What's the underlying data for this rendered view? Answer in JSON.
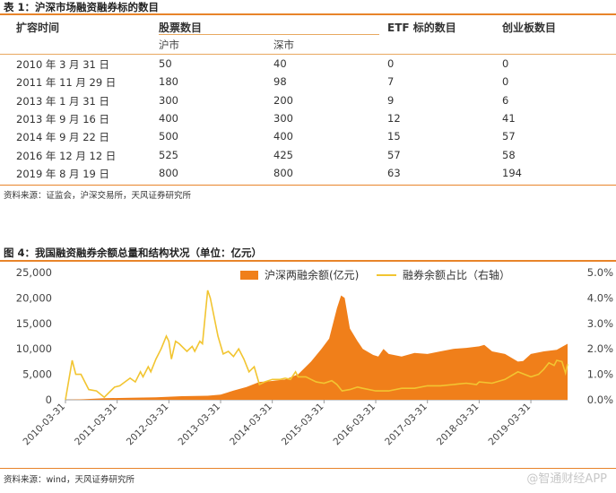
{
  "table": {
    "title": "表 1：沪深市场融资融券标的数目",
    "headers": {
      "date": "扩容时间",
      "stocks": "股票数目",
      "sh": "沪市",
      "sz": "深市",
      "etf": "ETF 标的数目",
      "gem": "创业板数目"
    },
    "rows": [
      {
        "date": "2010 年 3 月 31 日",
        "sh": "50",
        "sz": "40",
        "etf": "0",
        "gem": "0"
      },
      {
        "date": "2011 年 11 月 29 日",
        "sh": "180",
        "sz": "98",
        "etf": "7",
        "gem": "0"
      },
      {
        "date": "2013 年 1 月 31 日",
        "sh": "300",
        "sz": "200",
        "etf": "9",
        "gem": "6"
      },
      {
        "date": "2013 年 9 月 16 日",
        "sh": "400",
        "sz": "300",
        "etf": "12",
        "gem": "41"
      },
      {
        "date": "2014 年 9 月 22 日",
        "sh": "500",
        "sz": "400",
        "etf": "15",
        "gem": "57"
      },
      {
        "date": "2016 年 12 月 12 日",
        "sh": "525",
        "sz": "425",
        "etf": "57",
        "gem": "58"
      },
      {
        "date": "2019 年 8 月 19 日",
        "sh": "800",
        "sz": "800",
        "etf": "63",
        "gem": "194"
      }
    ],
    "source": "资料来源：证监会，沪深交易所，天风证券研究所"
  },
  "figure": {
    "title": "图 4：我国融资融券余额总量和结构状况（单位：亿元）",
    "source": "资料来源：wind，天风证券研究所"
  },
  "watermark": "@智通财经APP",
  "colors": {
    "accent": "#e8842a",
    "area": "#f07f1a",
    "line": "#f2c531"
  },
  "chart_data": {
    "type": "area",
    "legend": [
      "沪深两融余额(亿元)",
      "融券余额占比（右轴）"
    ],
    "legend_position": "top-right",
    "x_ticks": [
      "2010-03-31",
      "2011-03-31",
      "2012-03-31",
      "2013-03-31",
      "2014-03-31",
      "2015-03-31",
      "2016-03-31",
      "2017-03-31",
      "2018-03-31",
      "2019-03-31"
    ],
    "y_left": {
      "range": [
        0,
        25000
      ],
      "ticks": [
        "0",
        "5,000",
        "10,000",
        "15,000",
        "20,000",
        "25,000"
      ]
    },
    "y_right": {
      "range": [
        0,
        5
      ],
      "ticks": [
        "0.0%",
        "1.0%",
        "2.0%",
        "3.0%",
        "4.0%",
        "5.0%"
      ]
    },
    "x_range": [
      2010.25,
      2019.96
    ],
    "series": [
      {
        "name": "沪深两融余额(亿元)",
        "axis": "left",
        "points": [
          [
            2010.25,
            0
          ],
          [
            2010.6,
            100
          ],
          [
            2011.0,
            300
          ],
          [
            2011.5,
            400
          ],
          [
            2012.0,
            500
          ],
          [
            2012.5,
            700
          ],
          [
            2013.0,
            800
          ],
          [
            2013.25,
            1000
          ],
          [
            2013.5,
            1800
          ],
          [
            2013.75,
            2500
          ],
          [
            2014.0,
            3500
          ],
          [
            2014.25,
            3700
          ],
          [
            2014.5,
            4000
          ],
          [
            2014.75,
            5000
          ],
          [
            2015.0,
            7500
          ],
          [
            2015.2,
            10000
          ],
          [
            2015.35,
            12000
          ],
          [
            2015.5,
            18000
          ],
          [
            2015.58,
            20500
          ],
          [
            2015.65,
            20000
          ],
          [
            2015.75,
            14000
          ],
          [
            2015.9,
            11500
          ],
          [
            2016.0,
            10000
          ],
          [
            2016.2,
            8800
          ],
          [
            2016.3,
            8500
          ],
          [
            2016.4,
            10000
          ],
          [
            2016.5,
            9000
          ],
          [
            2016.75,
            8500
          ],
          [
            2017.0,
            9200
          ],
          [
            2017.25,
            9000
          ],
          [
            2017.5,
            9500
          ],
          [
            2017.75,
            10000
          ],
          [
            2018.0,
            10200
          ],
          [
            2018.25,
            10500
          ],
          [
            2018.35,
            10800
          ],
          [
            2018.5,
            9500
          ],
          [
            2018.75,
            9000
          ],
          [
            2019.0,
            7500
          ],
          [
            2019.1,
            7600
          ],
          [
            2019.25,
            9000
          ],
          [
            2019.5,
            9500
          ],
          [
            2019.75,
            9800
          ],
          [
            2019.96,
            11000
          ]
        ]
      },
      {
        "name": "融券余额占比（右轴）",
        "axis": "right",
        "points": [
          [
            2010.25,
            0.0
          ],
          [
            2010.38,
            1.55
          ],
          [
            2010.45,
            1.0
          ],
          [
            2010.55,
            1.0
          ],
          [
            2010.7,
            0.4
          ],
          [
            2010.85,
            0.35
          ],
          [
            2011.0,
            0.1
          ],
          [
            2011.1,
            0.3
          ],
          [
            2011.2,
            0.5
          ],
          [
            2011.3,
            0.55
          ],
          [
            2011.4,
            0.7
          ],
          [
            2011.5,
            0.85
          ],
          [
            2011.6,
            0.7
          ],
          [
            2011.7,
            1.1
          ],
          [
            2011.75,
            0.9
          ],
          [
            2011.85,
            1.3
          ],
          [
            2011.9,
            1.1
          ],
          [
            2012.0,
            1.6
          ],
          [
            2012.1,
            2.0
          ],
          [
            2012.2,
            2.5
          ],
          [
            2012.25,
            2.3
          ],
          [
            2012.3,
            1.6
          ],
          [
            2012.38,
            2.3
          ],
          [
            2012.45,
            2.2
          ],
          [
            2012.55,
            2.0
          ],
          [
            2012.6,
            1.9
          ],
          [
            2012.7,
            2.1
          ],
          [
            2012.75,
            1.9
          ],
          [
            2012.85,
            2.3
          ],
          [
            2012.9,
            2.2
          ],
          [
            2013.0,
            4.3
          ],
          [
            2013.05,
            4.0
          ],
          [
            2013.1,
            3.5
          ],
          [
            2013.2,
            2.5
          ],
          [
            2013.3,
            1.8
          ],
          [
            2013.4,
            1.9
          ],
          [
            2013.5,
            1.7
          ],
          [
            2013.6,
            2.0
          ],
          [
            2013.7,
            1.6
          ],
          [
            2013.8,
            1.1
          ],
          [
            2013.9,
            1.3
          ],
          [
            2014.0,
            0.6
          ],
          [
            2014.1,
            0.7
          ],
          [
            2014.25,
            0.8
          ],
          [
            2014.4,
            0.8
          ],
          [
            2014.5,
            0.85
          ],
          [
            2014.6,
            0.8
          ],
          [
            2014.7,
            1.1
          ],
          [
            2014.75,
            0.9
          ],
          [
            2014.9,
            0.9
          ],
          [
            2015.0,
            0.8
          ],
          [
            2015.1,
            0.7
          ],
          [
            2015.25,
            0.65
          ],
          [
            2015.4,
            0.75
          ],
          [
            2015.5,
            0.6
          ],
          [
            2015.6,
            0.35
          ],
          [
            2015.75,
            0.4
          ],
          [
            2015.9,
            0.5
          ],
          [
            2016.0,
            0.45
          ],
          [
            2016.25,
            0.35
          ],
          [
            2016.5,
            0.35
          ],
          [
            2016.75,
            0.45
          ],
          [
            2017.0,
            0.45
          ],
          [
            2017.25,
            0.55
          ],
          [
            2017.5,
            0.55
          ],
          [
            2017.75,
            0.6
          ],
          [
            2018.0,
            0.65
          ],
          [
            2018.2,
            0.6
          ],
          [
            2018.25,
            0.7
          ],
          [
            2018.5,
            0.65
          ],
          [
            2018.75,
            0.8
          ],
          [
            2019.0,
            1.1
          ],
          [
            2019.25,
            0.9
          ],
          [
            2019.4,
            1.0
          ],
          [
            2019.5,
            1.2
          ],
          [
            2019.6,
            1.45
          ],
          [
            2019.7,
            1.35
          ],
          [
            2019.75,
            1.55
          ],
          [
            2019.85,
            1.5
          ],
          [
            2019.92,
            1.05
          ],
          [
            2019.96,
            1.4
          ]
        ]
      }
    ]
  }
}
